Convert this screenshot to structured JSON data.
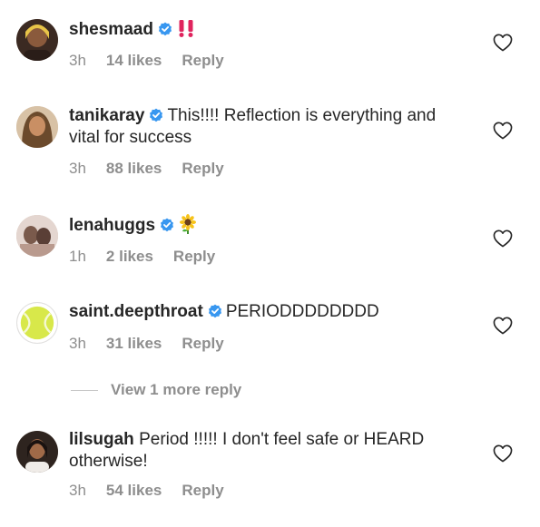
{
  "comments": [
    {
      "username": "shesmaad",
      "verified": true,
      "text": "‼️",
      "time": "3h",
      "likes": "14 likes",
      "reply": "Reply"
    },
    {
      "username": "tanikaray",
      "verified": true,
      "text": "This!!!! Reflection is everything and vital for success",
      "time": "3h",
      "likes": "88 likes",
      "reply": "Reply"
    },
    {
      "username": "lenahuggs",
      "verified": true,
      "text": "🌻",
      "time": "1h",
      "likes": "2 likes",
      "reply": "Reply"
    },
    {
      "username": "saint.deepthroat",
      "verified": true,
      "text": "PERIODDDDDDDD",
      "time": "3h",
      "likes": "31 likes",
      "reply": "Reply"
    },
    {
      "username": "lilsugah",
      "verified": false,
      "text": "Period !!!!! I don't feel safe or HEARD otherwise!",
      "time": "3h",
      "likes": "54 likes",
      "reply": "Reply"
    }
  ],
  "view_more": "View 1 more reply",
  "colors": {
    "text": "#262626",
    "secondary": "#8e8e8e",
    "verified": "#3897f0",
    "double_exclamation": "#e0245e"
  },
  "icons": {
    "verified": "verified-badge-icon",
    "heart": "heart-outline-icon",
    "double_exclamation": "double-exclamation-emoji",
    "sunflower": "sunflower-emoji"
  }
}
